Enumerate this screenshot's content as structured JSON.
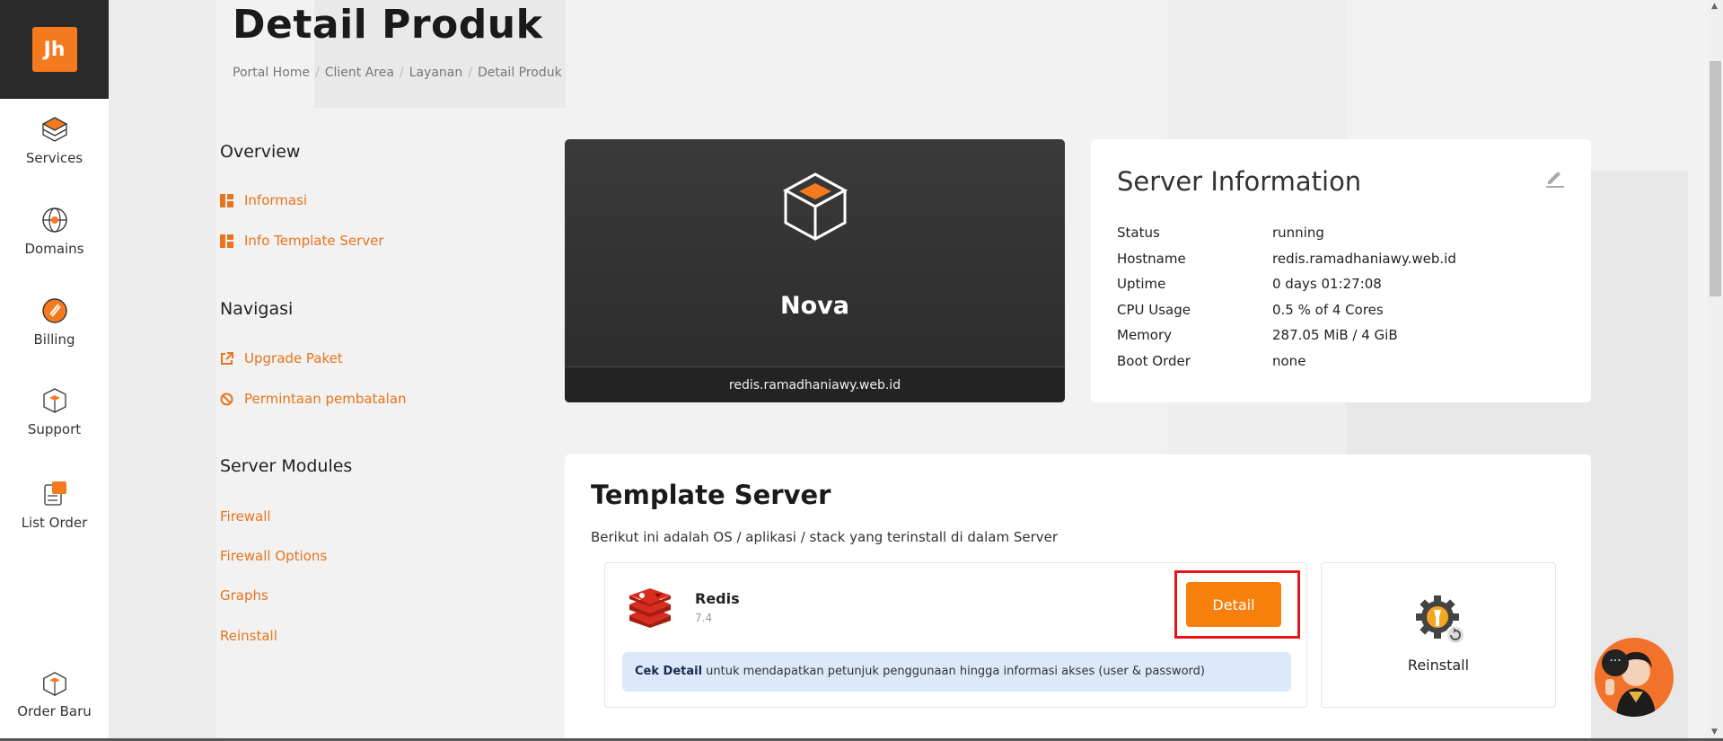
{
  "logo": {
    "text": "Jh"
  },
  "sidebar": {
    "items": [
      {
        "label": "Services",
        "icon": "services-box-icon"
      },
      {
        "label": "Domains",
        "icon": "globe-icon"
      },
      {
        "label": "Billing",
        "icon": "billing-icon"
      },
      {
        "label": "Support",
        "icon": "support-icon"
      },
      {
        "label": "List Order",
        "icon": "list-order-icon"
      }
    ],
    "bottom_item": {
      "label": "Order Baru",
      "icon": "order-box-icon"
    }
  },
  "page": {
    "title": "Detail Produk",
    "breadcrumb": [
      "Portal Home",
      "Client Area",
      "Layanan",
      "Detail Produk"
    ]
  },
  "menu": {
    "overview": {
      "heading": "Overview",
      "links": [
        "Informasi",
        "Info Template Server"
      ]
    },
    "navigasi": {
      "heading": "Navigasi",
      "links": [
        "Upgrade Paket",
        "Permintaan pembatalan"
      ]
    },
    "server_modules": {
      "heading": "Server Modules",
      "links": [
        "Firewall",
        "Firewall Options",
        "Graphs",
        "Reinstall"
      ]
    }
  },
  "product": {
    "name": "Nova",
    "hostname": "redis.ramadhaniawy.web.id"
  },
  "server_info": {
    "title": "Server Information",
    "rows": [
      {
        "key": "Status",
        "value": "running"
      },
      {
        "key": "Hostname",
        "value": "redis.ramadhaniawy.web.id"
      },
      {
        "key": "Uptime",
        "value": "0 days 01:27:08"
      },
      {
        "key": "CPU Usage",
        "value": "0.5 % of 4 Cores"
      },
      {
        "key": "Memory",
        "value": "287.05 MiB / 4 GiB"
      },
      {
        "key": "Boot Order",
        "value": "none"
      }
    ]
  },
  "template_server": {
    "title": "Template Server",
    "subtitle": "Berikut ini adalah OS / aplikasi / stack yang terinstall di dalam Server",
    "app": {
      "name": "Redis",
      "version": "7.4",
      "detail_button": "Detail",
      "note_bold": "Cek Detail",
      "note_text": " untuk mendapatkan petunjuk penggunaan hingga informasi akses (user & password)"
    },
    "reinstall_label": "Reinstall"
  },
  "colors": {
    "accent": "#f47a20",
    "link": "#e8741c",
    "highlight_border": "#e8131b",
    "note_bg": "#dce9fb"
  }
}
